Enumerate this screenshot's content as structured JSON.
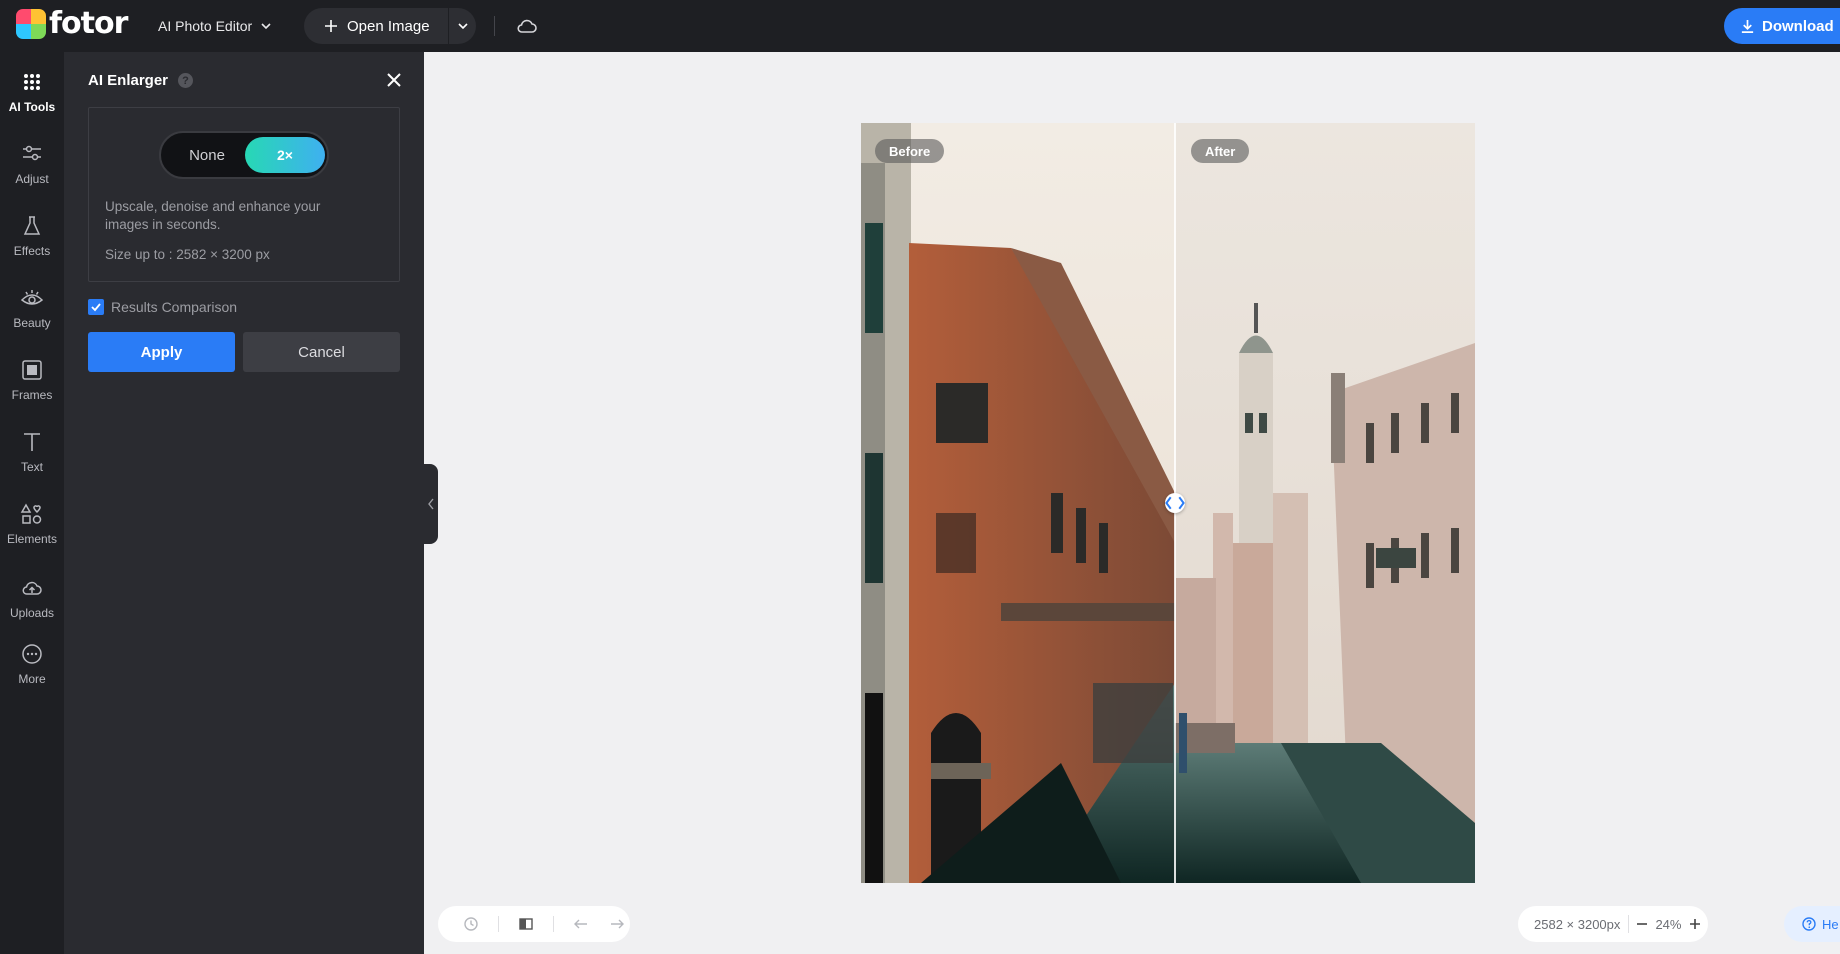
{
  "app": {
    "logo_text": "fotor",
    "editor_menu_label": "AI Photo Editor"
  },
  "toolbar": {
    "open_image_label": "Open Image",
    "download_label": "Download"
  },
  "rail": {
    "items": [
      {
        "label": "AI Tools",
        "icon": "grid-dots-icon"
      },
      {
        "label": "Adjust",
        "icon": "sliders-icon"
      },
      {
        "label": "Effects",
        "icon": "flask-icon"
      },
      {
        "label": "Beauty",
        "icon": "eye-icon"
      },
      {
        "label": "Frames",
        "icon": "frame-icon"
      },
      {
        "label": "Text",
        "icon": "text-icon"
      },
      {
        "label": "Elements",
        "icon": "shapes-icon"
      },
      {
        "label": "Uploads",
        "icon": "cloud-upload-icon"
      },
      {
        "label": "More",
        "icon": "more-dots-icon"
      }
    ]
  },
  "panel": {
    "title": "AI Enlarger",
    "toggle_none": "None",
    "toggle_2x": "2×",
    "description": "Upscale, denoise and enhance your images in seconds.",
    "size_text": "Size up to : 2582 × 3200 px",
    "results_comparison_label": "Results Comparison",
    "apply_label": "Apply",
    "cancel_label": "Cancel"
  },
  "canvas": {
    "before_label": "Before",
    "after_label": "After",
    "dimensions": "2582 × 3200px",
    "zoom": "24%",
    "help_label": "He"
  },
  "colors": {
    "accent": "#2a7cf6",
    "topbar_bg": "#1e1f23",
    "panel_bg": "#2a2b30",
    "canvas_bg": "#f0f0f2"
  }
}
